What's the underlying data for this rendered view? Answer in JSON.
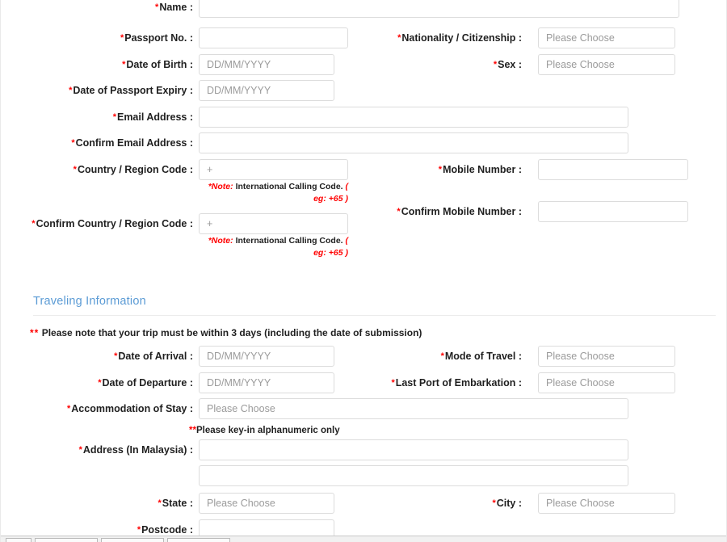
{
  "personal": {
    "fields": [
      {
        "label": "Name :",
        "required": true,
        "placeholder": ""
      },
      {
        "label": "Passport No. :",
        "required": true,
        "placeholder": ""
      },
      {
        "label": "Nationality / Citizenship :",
        "required": true,
        "placeholder": "Please Choose"
      },
      {
        "label": "Date of Birth :",
        "required": true,
        "placeholder": "DD/MM/YYYY"
      },
      {
        "label": "Sex :",
        "required": true,
        "placeholder": "Please Choose"
      },
      {
        "label": "Date of Passport Expiry :",
        "required": true,
        "placeholder": "DD/MM/YYYY"
      },
      {
        "label": "Email Address :",
        "required": true,
        "placeholder": ""
      },
      {
        "label": "Confirm Email Address :",
        "required": true,
        "placeholder": ""
      },
      {
        "label": "Country / Region Code :",
        "required": true,
        "placeholder": "+"
      },
      {
        "label": "Mobile Number :",
        "required": true,
        "placeholder": ""
      },
      {
        "label": "Confirm Country / Region Code :",
        "required": true,
        "placeholder": "+"
      },
      {
        "label": "Confirm Mobile Number :",
        "required": true,
        "placeholder": ""
      }
    ],
    "note_calling_code": {
      "label": "*Note:",
      "text": "International Calling Code.",
      "example": "( eg: +65 )"
    }
  },
  "traveling": {
    "heading": "Traveling Information",
    "trip_note": {
      "stars": "**",
      "text": "Please note that your trip must be within 3 days (including the date of submission)"
    },
    "alphanumeric_note": {
      "stars": "**",
      "text": "Please key-in alphanumeric only"
    },
    "fields": [
      {
        "label": "Date of Arrival :",
        "required": true,
        "placeholder": "DD/MM/YYYY"
      },
      {
        "label": "Mode of Travel :",
        "required": true,
        "placeholder": "Please Choose"
      },
      {
        "label": "Date of Departure :",
        "required": true,
        "placeholder": "DD/MM/YYYY"
      },
      {
        "label": "Last Port of Embarkation :",
        "required": true,
        "placeholder": "Please Choose"
      },
      {
        "label": "Accommodation of Stay :",
        "required": true,
        "placeholder": "Please Choose"
      },
      {
        "label": "Address (In Malaysia) :",
        "required": true,
        "placeholder": ""
      },
      {
        "label": "",
        "required": false,
        "placeholder": ""
      },
      {
        "label": "State :",
        "required": true,
        "placeholder": "Please Choose"
      },
      {
        "label": "City :",
        "required": true,
        "placeholder": "Please Choose"
      },
      {
        "label": "Postcode :",
        "required": true,
        "placeholder": ""
      }
    ]
  },
  "colors": {
    "required_asterisk": "#ff0000",
    "section_heading": "#5b9bd5",
    "field_border": "#dcdcdc",
    "placeholder": "#9b9b9b",
    "label_text": "#1f1f1f"
  }
}
